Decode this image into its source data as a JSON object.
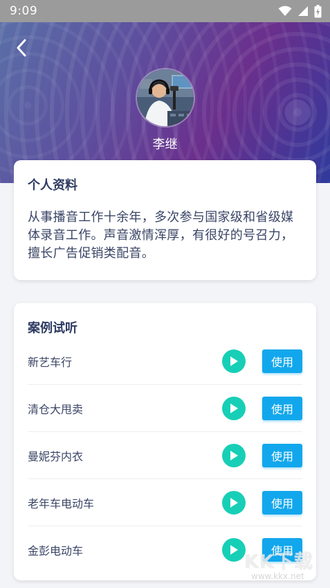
{
  "status_bar": {
    "time": "9:09",
    "icons": [
      "wifi-icon",
      "cell-signal-icon",
      "battery-charging-icon"
    ]
  },
  "header": {
    "back_icon": "chevron-left-icon",
    "name": "李继"
  },
  "profile": {
    "title": "个人资料",
    "description": "从事播音工作十余年，多次参与国家级和省级媒体录音工作。声音激情浑厚，有很好的号召力，擅长广告促销类配音。"
  },
  "cases": {
    "title": "案例试听",
    "use_label": "使用",
    "items": [
      {
        "name": "新艺车行"
      },
      {
        "name": "清仓大甩卖"
      },
      {
        "name": "曼妮芬内衣"
      },
      {
        "name": "老年车电动车"
      },
      {
        "name": "金彭电动车"
      }
    ]
  },
  "watermark": {
    "text": "KK下载",
    "url": "www.kkx.net"
  },
  "colors": {
    "play": "#17cfb6",
    "use_button": "#12a7ec",
    "status_bar": "#9b9b9b",
    "title_text": "#2e3b62"
  }
}
